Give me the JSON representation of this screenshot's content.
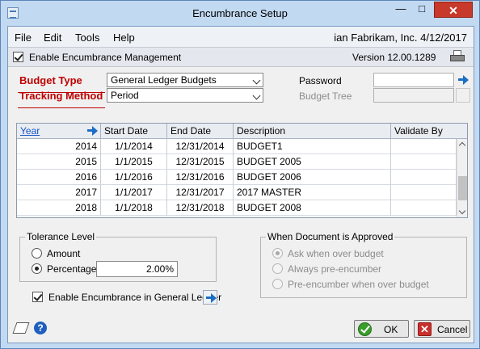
{
  "window": {
    "title": "Encumbrance Setup",
    "min_glyph": "—",
    "max_glyph": "□",
    "close_glyph": "✕"
  },
  "menu": [
    "File",
    "Edit",
    "Tools",
    "Help"
  ],
  "userinfo": "ian  Fabrikam, Inc.  4/12/2017",
  "toolbar": {
    "enable_label": "Enable Encumbrance Management",
    "enable_checked": true,
    "version": "Version 12.00.1289"
  },
  "fields": {
    "budget_type_label": "Budget Type",
    "budget_type_value": "General Ledger Budgets",
    "tracking_method_label": "Tracking Method",
    "tracking_method_value": "Period",
    "password_label": "Password",
    "budget_tree_label": "Budget Tree"
  },
  "grid": {
    "columns": [
      "Year",
      "Start Date",
      "End Date",
      "Description",
      "Validate By"
    ],
    "rows": [
      {
        "year": "2014",
        "start": "1/1/2014",
        "end": "12/31/2014",
        "desc": "BUDGET1",
        "validate": ""
      },
      {
        "year": "2015",
        "start": "1/1/2015",
        "end": "12/31/2015",
        "desc": "BUDGET 2005",
        "validate": ""
      },
      {
        "year": "2016",
        "start": "1/1/2016",
        "end": "12/31/2016",
        "desc": "BUDGET 2006",
        "validate": ""
      },
      {
        "year": "2017",
        "start": "1/1/2017",
        "end": "12/31/2017",
        "desc": "2017 MASTER",
        "validate": ""
      },
      {
        "year": "2018",
        "start": "1/1/2018",
        "end": "12/31/2018",
        "desc": "BUDGET 2008",
        "validate": ""
      }
    ]
  },
  "tolerance": {
    "title": "Tolerance Level",
    "amount_label": "Amount",
    "percentage_label": "Percentage",
    "selected": "Percentage",
    "percentage_value": "2.00%"
  },
  "enable_gl": {
    "label": "Enable Encumbrance in General Ledger",
    "checked": true
  },
  "approved": {
    "title": "When Document is Approved",
    "options": [
      "Ask when over budget",
      "Always pre-encumber",
      "Pre-encumber when over budget"
    ],
    "selected": "Ask when over budget"
  },
  "buttons": {
    "ok": "OK",
    "cancel": "Cancel",
    "help_glyph": "?"
  }
}
